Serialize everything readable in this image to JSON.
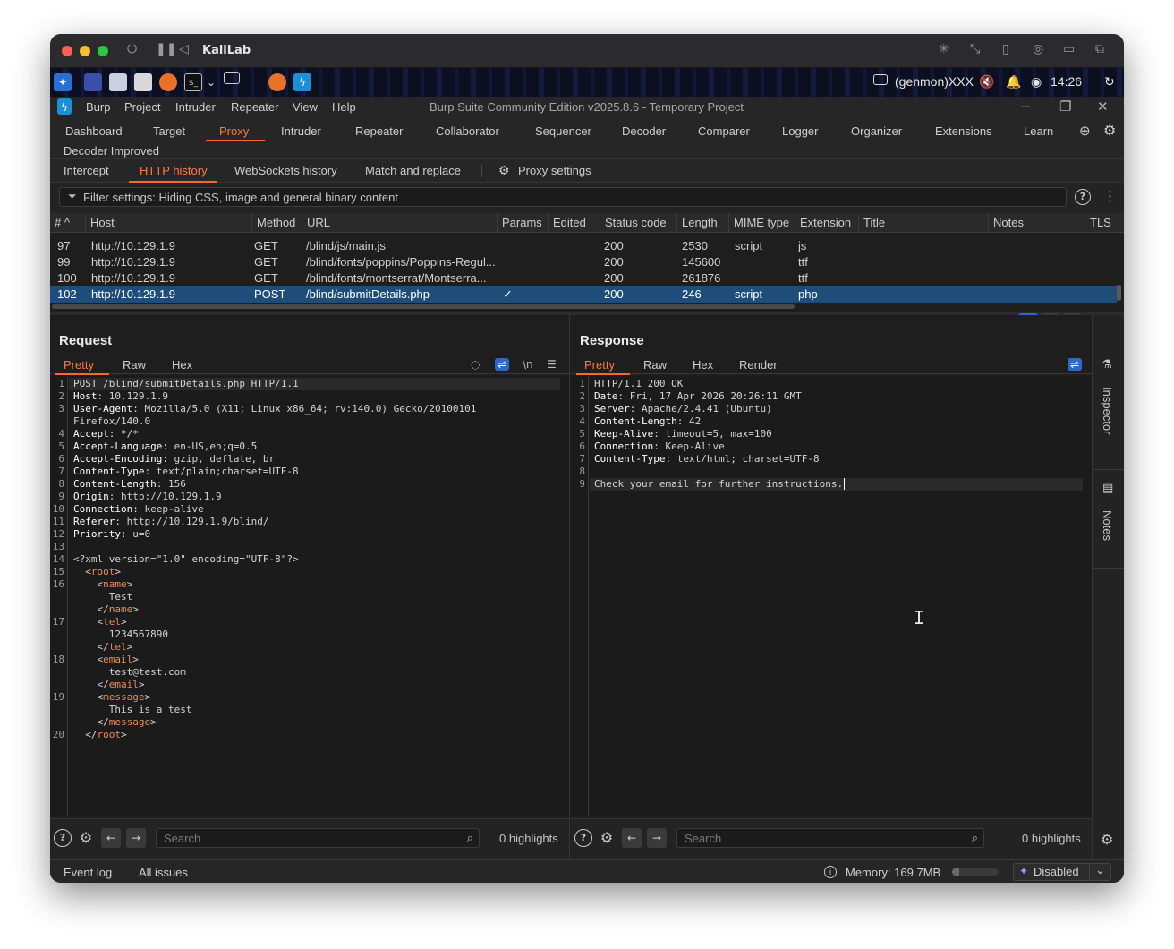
{
  "vm": {
    "title": "KaliLab",
    "colors": {
      "red": "#ff5f57",
      "yellow": "#febc2e",
      "green": "#28c840"
    }
  },
  "taskbar": {
    "user": "(genmon)XXX",
    "clock": "14:26"
  },
  "menubar": {
    "items": [
      "Burp",
      "Project",
      "Intruder",
      "Repeater",
      "View",
      "Help"
    ],
    "app_title": "Burp Suite Community Edition v2025.8.6 - Temporary Project"
  },
  "tools": {
    "tabs": [
      "Dashboard",
      "Target",
      "Proxy",
      "Intruder",
      "Repeater",
      "Collaborator",
      "Sequencer",
      "Decoder",
      "Comparer",
      "Logger",
      "Organizer",
      "Extensions",
      "Learn"
    ],
    "extra_tab": "Decoder Improved",
    "active": "Proxy"
  },
  "proxy_tabs": {
    "tabs": [
      "Intercept",
      "HTTP history",
      "WebSockets history",
      "Match and replace"
    ],
    "settings": "Proxy settings",
    "active": "HTTP history"
  },
  "filter": {
    "text": "Filter settings: Hiding CSS, image and general binary content"
  },
  "history": {
    "columns": [
      "#",
      "Host",
      "Method",
      "URL",
      "Params",
      "Edited",
      "Status code",
      "Length",
      "MIME type",
      "Extension",
      "Title",
      "Notes",
      "TLS"
    ],
    "rows": [
      {
        "num": "97",
        "host": "http://10.129.1.9",
        "method": "GET",
        "url": "/blind/js/main.js",
        "params": "",
        "status": "200",
        "length": "2530",
        "mime": "script",
        "ext": "js"
      },
      {
        "num": "99",
        "host": "http://10.129.1.9",
        "method": "GET",
        "url": "/blind/fonts/poppins/Poppins-Regul...",
        "params": "",
        "status": "200",
        "length": "145600",
        "mime": "",
        "ext": "ttf"
      },
      {
        "num": "100",
        "host": "http://10.129.1.9",
        "method": "GET",
        "url": "/blind/fonts/montserrat/Montserra...",
        "params": "",
        "status": "200",
        "length": "261876",
        "mime": "",
        "ext": "ttf"
      },
      {
        "num": "102",
        "host": "http://10.129.1.9",
        "method": "POST",
        "url": "/blind/submitDetails.php",
        "params": "✓",
        "status": "200",
        "length": "246",
        "mime": "script",
        "ext": "php"
      }
    ],
    "selected_index": 3
  },
  "request": {
    "title": "Request",
    "tabs": [
      "Pretty",
      "Raw",
      "Hex"
    ],
    "active_tab": "Pretty",
    "lines": [
      {
        "n": "1",
        "t": "POST /blind/submitDetails.php HTTP/1.1"
      },
      {
        "n": "2",
        "t": "Host: 10.129.1.9"
      },
      {
        "n": "3",
        "t": "User-Agent: Mozilla/5.0 (X11; Linux x86_64; rv:140.0) Gecko/20100101"
      },
      {
        "n": "",
        "t": "Firefox/140.0"
      },
      {
        "n": "4",
        "t": "Accept: */*"
      },
      {
        "n": "5",
        "t": "Accept-Language: en-US,en;q=0.5"
      },
      {
        "n": "6",
        "t": "Accept-Encoding: gzip, deflate, br"
      },
      {
        "n": "7",
        "t": "Content-Type: text/plain;charset=UTF-8"
      },
      {
        "n": "8",
        "t": "Content-Length: 156"
      },
      {
        "n": "9",
        "t": "Origin: http://10.129.1.9"
      },
      {
        "n": "10",
        "t": "Connection: keep-alive"
      },
      {
        "n": "11",
        "t": "Referer: http://10.129.1.9/blind/"
      },
      {
        "n": "12",
        "t": "Priority: u=0"
      },
      {
        "n": "13",
        "t": ""
      },
      {
        "n": "14",
        "t": "<?xml version=\"1.0\" encoding=\"UTF-8\"?>"
      },
      {
        "n": "15",
        "t": "  <root>"
      },
      {
        "n": "16",
        "t": "    <name>"
      },
      {
        "n": "",
        "t": "      Test"
      },
      {
        "n": "",
        "t": "    </name>"
      },
      {
        "n": "17",
        "t": "    <tel>"
      },
      {
        "n": "",
        "t": "      1234567890"
      },
      {
        "n": "",
        "t": "    </tel>"
      },
      {
        "n": "18",
        "t": "    <email>"
      },
      {
        "n": "",
        "t": "      test@test.com"
      },
      {
        "n": "",
        "t": "    </email>"
      },
      {
        "n": "19",
        "t": "    <message>"
      },
      {
        "n": "",
        "t": "      This is a test"
      },
      {
        "n": "",
        "t": "    </message>"
      },
      {
        "n": "20",
        "t": "  </root>"
      }
    ],
    "search_placeholder": "Search",
    "highlights": "0 highlights"
  },
  "response": {
    "title": "Response",
    "tabs": [
      "Pretty",
      "Raw",
      "Hex",
      "Render"
    ],
    "active_tab": "Pretty",
    "lines": [
      {
        "n": "1",
        "t": "HTTP/1.1 200 OK"
      },
      {
        "n": "2",
        "t": "Date: Fri, 17 Apr 2026 20:26:11 GMT"
      },
      {
        "n": "3",
        "t": "Server: Apache/2.4.41 (Ubuntu)"
      },
      {
        "n": "4",
        "t": "Content-Length: 42"
      },
      {
        "n": "5",
        "t": "Keep-Alive: timeout=5, max=100"
      },
      {
        "n": "6",
        "t": "Connection: Keep-Alive"
      },
      {
        "n": "7",
        "t": "Content-Type: text/html; charset=UTF-8"
      },
      {
        "n": "8",
        "t": ""
      },
      {
        "n": "9",
        "t": "Check your email for further instructions."
      }
    ],
    "search_placeholder": "Search",
    "highlights": "0 highlights"
  },
  "sidebar": {
    "inspector": "Inspector",
    "notes": "Notes"
  },
  "status": {
    "event_log": "Event log",
    "all_issues": "All issues",
    "memory": "Memory: 169.7MB",
    "memory_fraction": 0.15,
    "disabled": "Disabled"
  }
}
